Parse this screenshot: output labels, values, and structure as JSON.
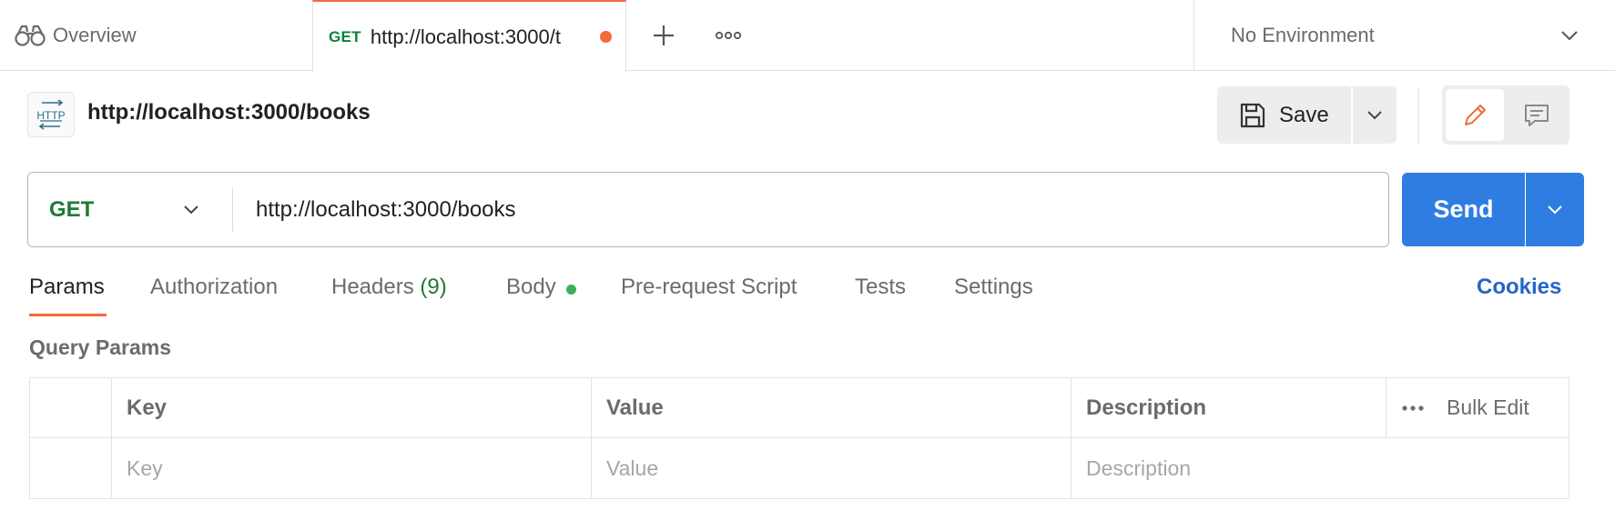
{
  "tabs": {
    "overview_label": "Overview",
    "active": {
      "method": "GET",
      "url": "http://localhost:3000/t"
    }
  },
  "environment": {
    "selected": "No Environment"
  },
  "request": {
    "title": "http://localhost:3000/books",
    "icon_text": "HTTP",
    "save_label": "Save",
    "method": "GET",
    "url": "http://localhost:3000/books",
    "send_label": "Send"
  },
  "subtabs": {
    "params": "Params",
    "authorization": "Authorization",
    "headers": "Headers",
    "headers_count": "(9)",
    "body": "Body",
    "prerequest": "Pre-request Script",
    "tests": "Tests",
    "settings": "Settings",
    "cookies": "Cookies"
  },
  "query_params": {
    "title": "Query Params",
    "columns": [
      "Key",
      "Value",
      "Description"
    ],
    "bulk_edit": "Bulk Edit",
    "placeholders": {
      "key": "Key",
      "value": "Value",
      "description": "Description"
    }
  },
  "colors": {
    "accent_orange": "#f26b3a",
    "send_blue": "#2f7de1",
    "method_green": "#1f7a35",
    "cookies_blue": "#2465c9",
    "body_dot_green": "#3fae5a"
  },
  "icons": [
    "binoculars-icon",
    "unsaved-dot-icon",
    "plus-icon",
    "more-horizontal-icon",
    "chevron-down-icon",
    "http-request-icon",
    "save-disk-icon",
    "pencil-icon",
    "comment-icon"
  ]
}
